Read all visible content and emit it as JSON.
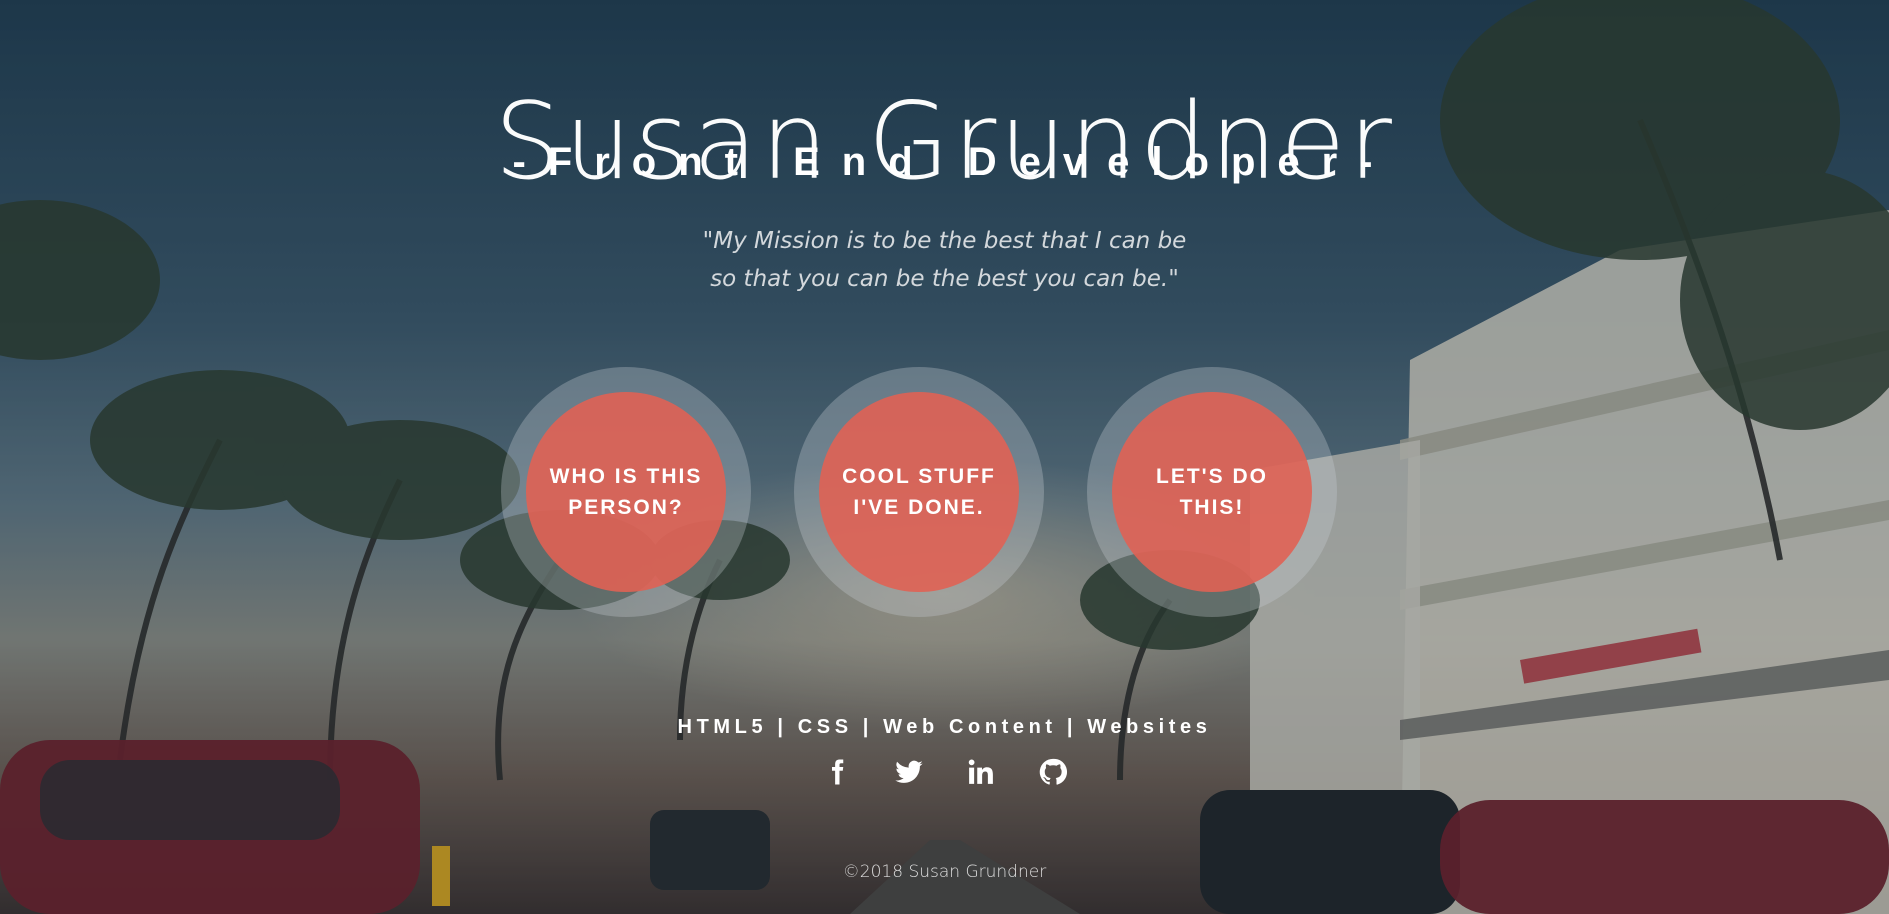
{
  "header": {
    "title": "Susan Grundner",
    "subtitle": "-Front End Developer-"
  },
  "mission": {
    "line1": "\"My Mission is to be the best that I can be",
    "line2": "so that you can be the best you can be.\""
  },
  "circles": [
    {
      "line1": "WHO IS THIS",
      "line2": "PERSON?"
    },
    {
      "line1": "COOL STUFF",
      "line2": "I'VE DONE."
    },
    {
      "line1": "LET'S DO",
      "line2": "THIS!"
    }
  ],
  "footer": {
    "skills": "HTML5 | CSS | Web Content | Websites",
    "social": [
      "facebook-icon",
      "twitter-icon",
      "linkedin-icon",
      "github-icon"
    ],
    "copyright": "©2018 Susan Grundner"
  },
  "colors": {
    "circle_fill": "#e06254",
    "text": "#ffffff"
  }
}
